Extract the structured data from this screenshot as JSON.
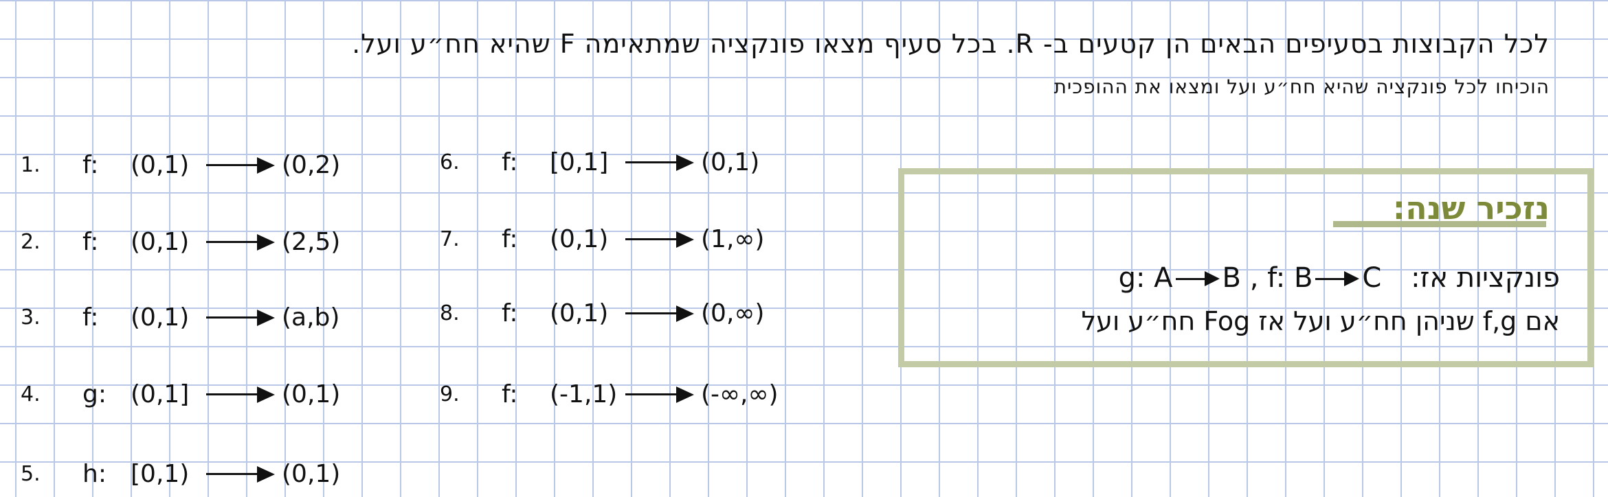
{
  "instructions": {
    "line1": "לכל הקבוצות בסעיפים הבאים הן קטעים ב- R. בכל סעיף מצאו פונקציה שמתאימה F שהיא חח״ע ועל.",
    "line2": "הוכיחו לכל פונקציה שהיא חח״ע ועל ומצאו את ההופכית"
  },
  "exercises": [
    {
      "num": "1.",
      "name": "f:",
      "domain": "(0,1)",
      "codomain": "(0,2)"
    },
    {
      "num": "2.",
      "name": "f:",
      "domain": "(0,1)",
      "codomain": "(2,5)"
    },
    {
      "num": "3.",
      "name": "f:",
      "domain": "(0,1)",
      "codomain": "(a,b)"
    },
    {
      "num": "4.",
      "name": "g:",
      "domain": "(0,1]",
      "codomain": "(0,1)"
    },
    {
      "num": "5.",
      "name": "h:",
      "domain": "[0,1)",
      "codomain": "(0,1)"
    },
    {
      "num": "6.",
      "name": "f:",
      "domain": "[0,1]",
      "codomain": "(0,1)"
    },
    {
      "num": "7.",
      "name": "f:",
      "domain": "(0,1)",
      "codomain": "(1,∞)"
    },
    {
      "num": "8.",
      "name": "f:",
      "domain": "(0,1)",
      "codomain": "(0,∞)"
    },
    {
      "num": "9.",
      "name": "f:",
      "domain": "(-1,1)",
      "codomain": "(-∞,∞)"
    }
  ],
  "reminder": {
    "title": "נזכיר שנה:",
    "line1_prefix": "פונקציות אז:",
    "g_map": "g: A",
    "g_target": "B",
    "sep": ",",
    "f_map": "f: B",
    "f_target": "C",
    "line2": "אם f,g שניהן חח״ע ועל אז Fog חח״ע ועל"
  },
  "colors": {
    "grid": "#b9c8e6",
    "box_border": "#c3cba6",
    "title": "#7d8a3a"
  }
}
